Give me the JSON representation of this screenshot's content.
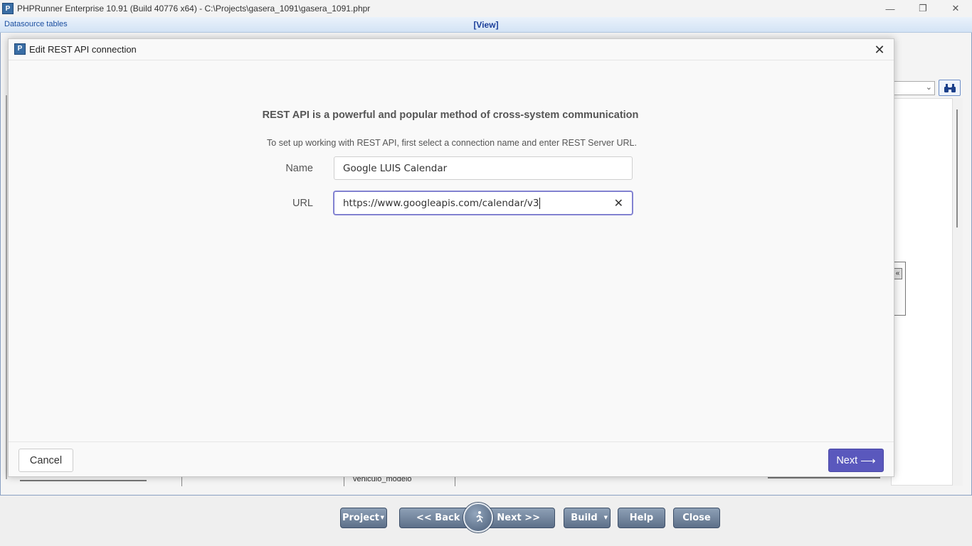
{
  "window": {
    "title": "PHPRunner Enterprise 10.91 (Build 40776 x64) - C:\\Projects\\gasera_1091\\gasera_1091.phpr",
    "minimize_glyph": "—",
    "maximize_glyph": "❐",
    "close_glyph": "✕"
  },
  "header": {
    "left_label": "Datasource tables",
    "center_label": "[View]"
  },
  "background": {
    "bottom_cell_text": "vehiculo_modelo",
    "box_tab_glyph": "«",
    "find_icon": "binoculars-icon"
  },
  "dialog": {
    "title": "Edit REST API connection",
    "close_glyph": "✕",
    "intro_title": "REST API is a powerful and popular method of cross-system communication",
    "intro_subtitle": "To set up working with REST API, first select a connection name and enter REST Server URL.",
    "name_label": "Name",
    "name_value": "Google LUIS Calendar",
    "url_label": "URL",
    "url_value": "https://www.googleapis.com/calendar/v3",
    "clear_glyph": "✕",
    "cancel_label": "Cancel",
    "next_label": "Next",
    "next_arrow": "⟶"
  },
  "toolbar": {
    "project_label": "Project",
    "back_label": "<< Back",
    "next_label": "Next >>",
    "build_label": "Build",
    "help_label": "Help",
    "close_label": "Close",
    "dropdown_glyph": "▼",
    "run_icon": "running-man-icon"
  },
  "colors": {
    "accent": "#5a58bd",
    "toolbar_button": "#6e8098",
    "header_blue": "#1c3f9a"
  }
}
